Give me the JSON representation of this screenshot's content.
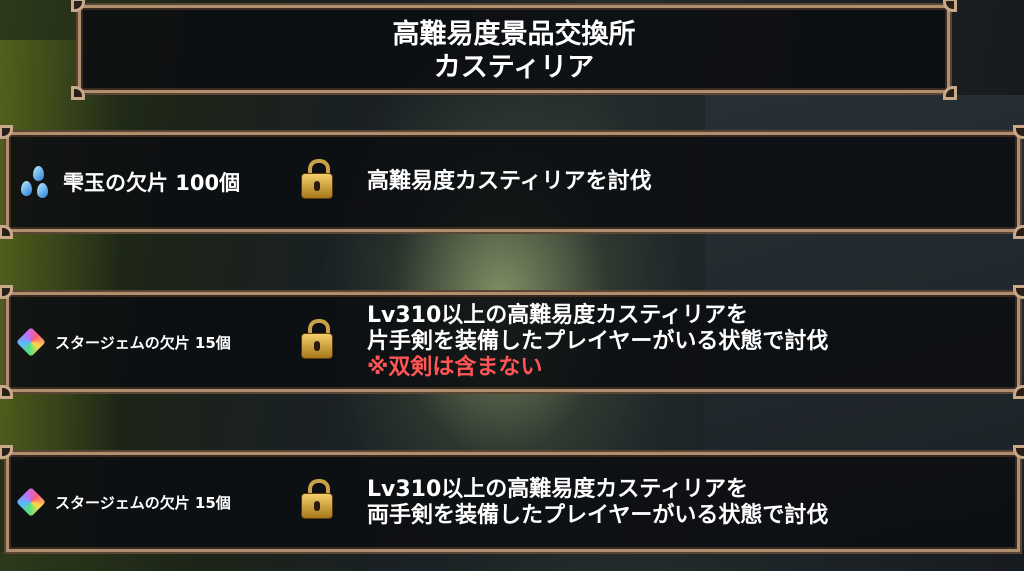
{
  "title": {
    "line1": "高難易度景品交換所",
    "line2": "カスティリア"
  },
  "rows": [
    {
      "reward_name": "雫玉の欠片  100個",
      "reward_icon": "blue-drops-icon",
      "lock_icon": "lock-icon",
      "condition_lines": [
        "高難易度カスティリアを討伐"
      ]
    },
    {
      "reward_name": "スタージェムの欠片  15個",
      "reward_icon": "star-gem-icon",
      "lock_icon": "lock-icon",
      "condition_lines": [
        "Lv310以上の高難易度カスティリアを",
        "片手剣を装備したプレイヤーがいる状態で討伐"
      ],
      "note": "※双剣は含まない"
    },
    {
      "reward_name": "スタージェムの欠片  15個",
      "reward_icon": "star-gem-icon",
      "lock_icon": "lock-icon",
      "condition_lines": [
        "Lv310以上の高難易度カスティリアを",
        "両手剣を装備したプレイヤーがいる状態で討伐"
      ]
    }
  ],
  "colors": {
    "frame": "#b08f6e",
    "note": "#ff5555",
    "lock": "#e0b04a"
  }
}
